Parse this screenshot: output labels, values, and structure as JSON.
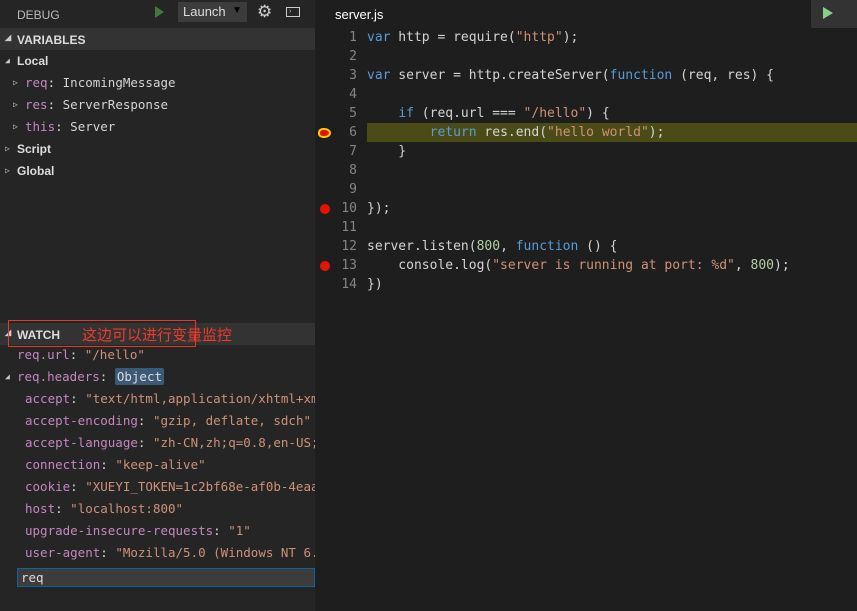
{
  "debug": {
    "title": "DEBUG",
    "config": "Launch",
    "icons": [
      "play-icon",
      "chevron-down-icon",
      "gear-icon",
      "terminal-icon"
    ]
  },
  "variables": {
    "title": "VARIABLES",
    "local": "Local",
    "items": [
      {
        "k": "req",
        "v": "IncomingMessage"
      },
      {
        "k": "res",
        "v": "ServerResponse"
      },
      {
        "k": "this",
        "v": "Server"
      }
    ],
    "script": "Script",
    "global": "Global"
  },
  "watch": {
    "title": "WATCH",
    "annotation": "这边可以进行变量监控",
    "url": {
      "k": "req.url",
      "v": "\"/hello\""
    },
    "headers": {
      "k": "req.headers",
      "v": "Object"
    },
    "header_items": [
      {
        "k": "accept",
        "v": "\"text/html,application/xhtml+xm…"
      },
      {
        "k": "accept-encoding",
        "v": "\"gzip, deflate, sdch\""
      },
      {
        "k": "accept-language",
        "v": "\"zh-CN,zh;q=0.8,en-US;…"
      },
      {
        "k": "connection",
        "v": "\"keep-alive\""
      },
      {
        "k": "cookie",
        "v": "\"XUEYI_TOKEN=1c2bf68e-af0b-4eaa…"
      },
      {
        "k": "host",
        "v": "\"localhost:800\""
      },
      {
        "k": "upgrade-insecure-requests",
        "v": "\"1\""
      },
      {
        "k": "user-agent",
        "v": "\"Mozilla/5.0 (Windows NT 6.…"
      }
    ],
    "input": "req"
  },
  "editor": {
    "tab": "server.js",
    "current_line": 6,
    "breakpoints": [
      6,
      10,
      13
    ],
    "lines": [
      [
        [
          "var",
          "kw"
        ],
        [
          " http = require(",
          ""
        ],
        [
          "\"http\"",
          "str"
        ],
        [
          ");",
          ""
        ]
      ],
      [],
      [
        [
          "var",
          "kw"
        ],
        [
          " server = http.createServer(",
          ""
        ],
        [
          "function",
          "kw"
        ],
        [
          " (req, res) {",
          ""
        ]
      ],
      [],
      [
        [
          "    ",
          ""
        ],
        [
          "if",
          "kw"
        ],
        [
          " (req.url === ",
          ""
        ],
        [
          "\"/hello\"",
          "str"
        ],
        [
          ") {",
          ""
        ]
      ],
      [
        [
          "        ",
          ""
        ],
        [
          "return",
          "kw"
        ],
        [
          " res.end(",
          ""
        ],
        [
          "\"hello world\"",
          "str"
        ],
        [
          ");",
          ""
        ]
      ],
      [
        [
          "    }",
          ""
        ]
      ],
      [],
      [],
      [
        [
          "});",
          ""
        ]
      ],
      [],
      [
        [
          "server.listen(",
          ""
        ],
        [
          "800",
          "num"
        ],
        [
          ", ",
          ""
        ],
        [
          "function",
          "kw"
        ],
        [
          " () {",
          ""
        ]
      ],
      [
        [
          "    console.log(",
          ""
        ],
        [
          "\"server is running at port: %d\"",
          "str"
        ],
        [
          ", ",
          ""
        ],
        [
          "800",
          "num"
        ],
        [
          ");",
          ""
        ]
      ],
      [
        [
          "})",
          ""
        ]
      ]
    ]
  }
}
